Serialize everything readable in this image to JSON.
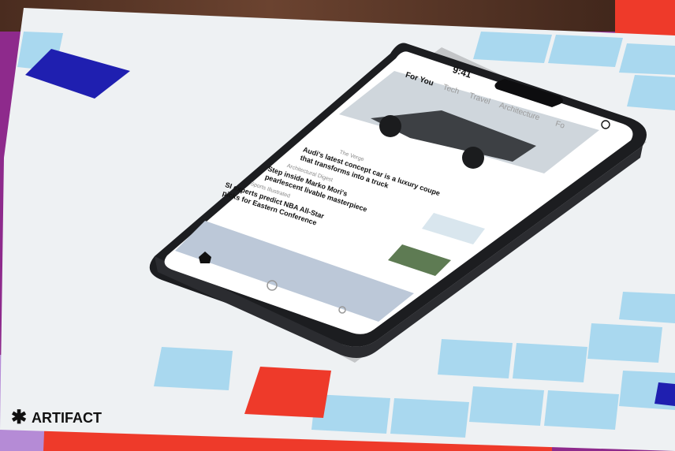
{
  "brand": {
    "name": "ARTIFACT",
    "mark": "✱"
  },
  "colors": {
    "background_purple": "#8e2a8c",
    "card_white": "#eef1f3",
    "tile_light_blue": "#a9d8ef",
    "tile_navy": "#1f1fb0",
    "tile_red": "#ee3a2a",
    "phone_frame": "#1c1d20"
  },
  "phone": {
    "status_time": "9:41",
    "tabs": [
      "For You",
      "Tech",
      "Travel",
      "Architecture",
      "Fo"
    ],
    "search_placeholder": "Search",
    "articles": [
      {
        "source": "The Verge",
        "headline_line1": "Audi's latest concept car is a luxury coupe",
        "headline_line2": "that transforms into a truck"
      },
      {
        "source": "Architectural Digest",
        "headline_line1": "Step inside Marko Mori's",
        "headline_line2": "pearlescent livable masterpiece"
      },
      {
        "source": "Sports Illustrated",
        "headline_line1": "SI experts predict NBA All-Star",
        "headline_line2": "picks for Eastern Conference"
      }
    ],
    "nav": [
      "home-icon",
      "explore-icon",
      "profile-icon"
    ]
  }
}
